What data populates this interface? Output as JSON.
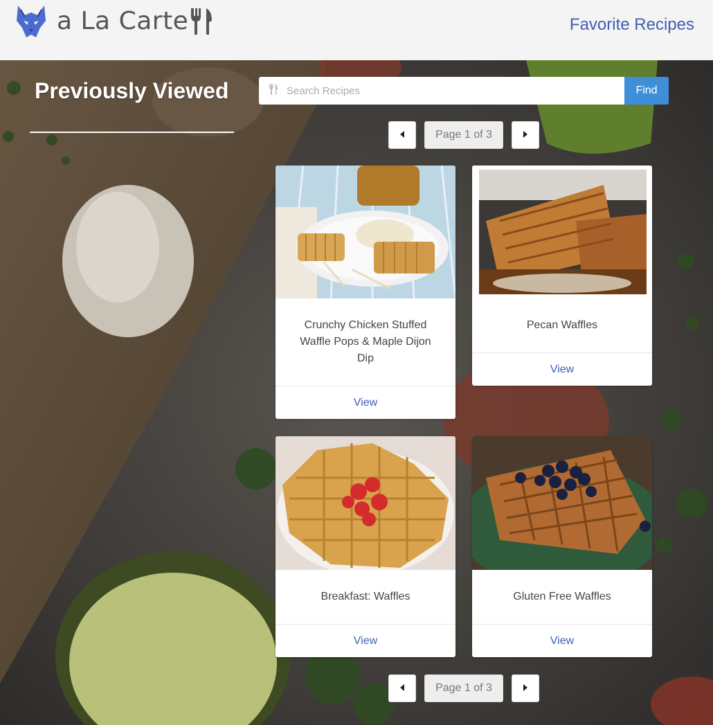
{
  "header": {
    "brand": "a La Carte",
    "favorites_link": "Favorite Recipes"
  },
  "sidebar": {
    "title": "Previously Viewed"
  },
  "search": {
    "placeholder": "Search Recipes",
    "value": "",
    "button_label": "Find"
  },
  "pagination": {
    "label": "Page 1 of 3",
    "current_page": 1,
    "total_pages": 3
  },
  "recipes": [
    {
      "name": "Crunchy Chicken Stuffed Waffle Pops & Maple Dijon Dip",
      "action": "View"
    },
    {
      "name": "Pecan Waffles",
      "action": "View"
    },
    {
      "name": "Breakfast: Waffles",
      "action": "View"
    },
    {
      "name": "Gluten Free Waffles",
      "action": "View"
    }
  ],
  "icons": {
    "logo": "wolf-head-icon",
    "brand_accent": "fork-knife-icon",
    "search": "fork-knife-icon",
    "prev": "caret-left-icon",
    "next": "caret-right-icon"
  },
  "colors": {
    "accent_link": "#3f5fb5",
    "find_button": "#3e8fd8",
    "logo_blue": "#4a6cd0",
    "header_bg": "#f4f4f4"
  }
}
